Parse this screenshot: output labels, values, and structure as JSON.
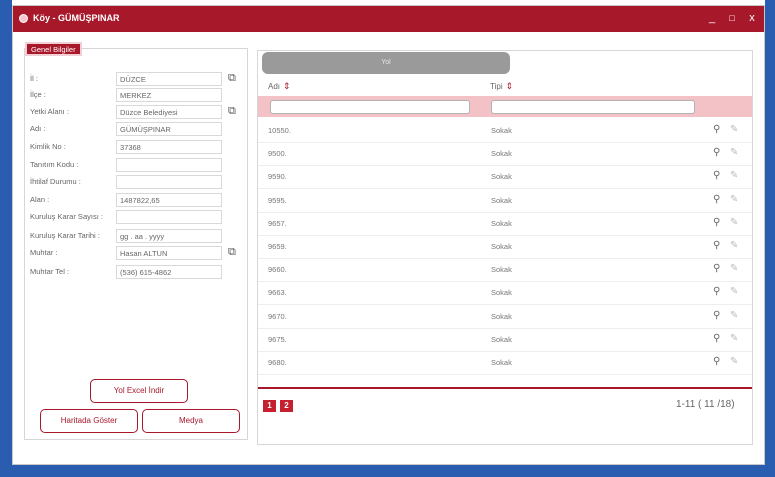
{
  "window": {
    "title": "Köy - GÜMÜŞPINAR",
    "minimize_label": "_",
    "maximize_label": "□",
    "close_label": "x"
  },
  "info_panel": {
    "legend": "Genel Bilgiler",
    "fields": [
      {
        "label": "İl :",
        "value": "DÜZCE",
        "has_link": true
      },
      {
        "label": "İlçe :",
        "value": "MERKEZ",
        "has_link": false
      },
      {
        "label": "Yetki Alanı :",
        "value": "Düzce Belediyesi",
        "has_link": true
      },
      {
        "label": "Adı :",
        "value": "GÜMÜŞPINAR",
        "has_link": false
      },
      {
        "label": "Kimlik No :",
        "value": "37368",
        "has_link": false
      },
      {
        "label": "Tanıtım Kodu :",
        "value": "",
        "has_link": false
      },
      {
        "label": "İhtilaf Durumu :",
        "value": "",
        "has_link": false
      },
      {
        "label": "Alan :",
        "value": "1487822,65",
        "has_link": false
      },
      {
        "label": "Kuruluş Karar Sayısı :",
        "value": "",
        "has_link": false
      },
      {
        "label": "Kuruluş Karar Tarihi :",
        "value": "gg . aa . yyyy",
        "has_link": false
      },
      {
        "label": "Muhtar :",
        "value": "Hasan ALTUN",
        "has_link": true
      },
      {
        "label": "Muhtar Tel :",
        "value": "(536) 615-4862",
        "has_link": false
      }
    ],
    "excel_button": "Yol Excel İndir",
    "map_button": "Haritada Göster",
    "media_button": "Medya"
  },
  "grid": {
    "add_button": "Yol",
    "columns": [
      "Adı",
      "Tipi"
    ],
    "rows": [
      {
        "name": "10550.",
        "type": "Sokak"
      },
      {
        "name": "9500.",
        "type": "Sokak"
      },
      {
        "name": "9590.",
        "type": "Sokak"
      },
      {
        "name": "9595.",
        "type": "Sokak"
      },
      {
        "name": "9657.",
        "type": "Sokak"
      },
      {
        "name": "9659.",
        "type": "Sokak"
      },
      {
        "name": "9660.",
        "type": "Sokak"
      },
      {
        "name": "9663.",
        "type": "Sokak"
      },
      {
        "name": "9670.",
        "type": "Sokak"
      },
      {
        "name": "9675.",
        "type": "Sokak"
      },
      {
        "name": "9680.",
        "type": "Sokak"
      }
    ],
    "pages": [
      "1",
      "2"
    ],
    "page_info": "1-11 ( 11 /18)"
  },
  "colors": {
    "accent": "#a7182a",
    "frame": "#2a5db0",
    "filter_row": "#f3c2c7"
  },
  "icons": {
    "link": "external-link-icon",
    "view": "magnifier-icon",
    "edit": "pencil-icon",
    "sort": "sort-arrows-icon"
  }
}
